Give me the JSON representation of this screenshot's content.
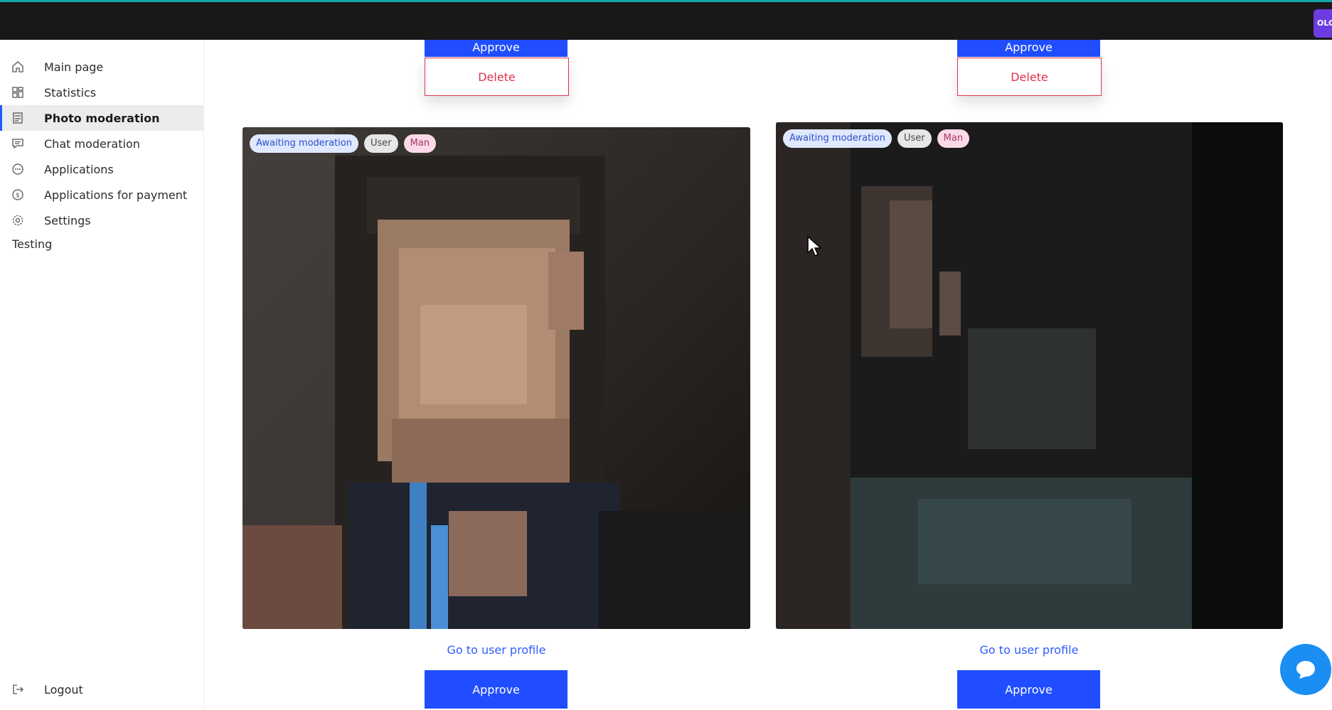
{
  "brand": {
    "badge_text": "OLO",
    "accent": "#6c3ce0"
  },
  "sidebar": {
    "items": [
      {
        "label": "Main page",
        "icon": "home-icon"
      },
      {
        "label": "Statistics",
        "icon": "dashboard-icon"
      },
      {
        "label": "Photo moderation",
        "icon": "photo-moderation-icon",
        "active": true
      },
      {
        "label": "Chat moderation",
        "icon": "chat-icon"
      },
      {
        "label": "Applications",
        "icon": "applications-icon"
      },
      {
        "label": "Applications for payment",
        "icon": "payment-icon"
      },
      {
        "label": "Settings",
        "icon": "gear-icon"
      }
    ],
    "testing_label": "Testing",
    "logout_label": "Logout"
  },
  "cards_top": [
    {
      "approve_label": "Approve",
      "delete_label": "Delete"
    },
    {
      "approve_label": "Approve",
      "delete_label": "Delete"
    }
  ],
  "cards": [
    {
      "tags": {
        "status": "Awaiting moderation",
        "role": "User",
        "gender": "Man"
      },
      "profile_link": "Go to user profile",
      "approve_label": "Approve"
    },
    {
      "tags": {
        "status": "Awaiting moderation",
        "role": "User",
        "gender": "Man"
      },
      "profile_link": "Go to user profile",
      "approve_label": "Approve"
    }
  ],
  "colors": {
    "approve": "#1f4dff",
    "delete": "#e0314b",
    "link": "#2e5cff",
    "active_indicator": "#1f5aff"
  }
}
